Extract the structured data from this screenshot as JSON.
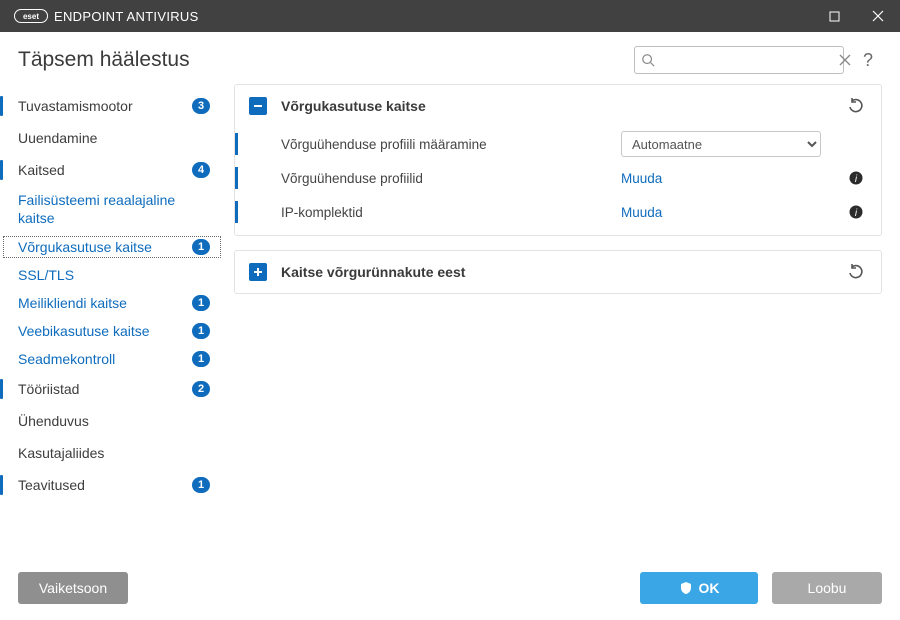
{
  "app": {
    "brand": "ENDPOINT ANTIVIRUS",
    "brand_prefix": "eset"
  },
  "heading": "Täpsem häälestus",
  "search": {
    "placeholder": ""
  },
  "sidebar": {
    "items": [
      {
        "label": "Tuvastamismootor",
        "badge": "3",
        "top": true,
        "marked": true
      },
      {
        "label": "Uuendamine",
        "top": true
      },
      {
        "label": "Kaitsed",
        "badge": "4",
        "top": true,
        "marked": true
      },
      {
        "label": "Failisüsteemi reaalajaline kaitse",
        "lvl2": true,
        "wrap": true
      },
      {
        "label": "Võrgukasutuse kaitse",
        "badge": "1",
        "lvl2": true,
        "selected": true
      },
      {
        "label": "SSL/TLS",
        "lvl2": true
      },
      {
        "label": "Meilikliendi kaitse",
        "badge": "1",
        "lvl2": true
      },
      {
        "label": "Veebikasutuse kaitse",
        "badge": "1",
        "lvl2": true
      },
      {
        "label": "Seadmekontroll",
        "badge": "1",
        "lvl2": true
      },
      {
        "label": "Tööriistad",
        "badge": "2",
        "top": true,
        "marked": true
      },
      {
        "label": "Ühenduvus",
        "top": true
      },
      {
        "label": "Kasutajaliides",
        "top": true
      },
      {
        "label": "Teavitused",
        "badge": "1",
        "top": true,
        "marked": true
      }
    ]
  },
  "panels": {
    "p1": {
      "title": "Võrgukasutuse kaitse",
      "rows": {
        "r1": {
          "label": "Võrguühenduse profiili määramine",
          "dropdown": "Automaatne"
        },
        "r2": {
          "label": "Võrguühenduse profiilid",
          "link": "Muuda"
        },
        "r3": {
          "label": "IP-komplektid",
          "link": "Muuda"
        }
      }
    },
    "p2": {
      "title": "Kaitse võrgurünnakute eest"
    }
  },
  "footer": {
    "default": "Vaiketsoon",
    "ok": "OK",
    "cancel": "Loobu"
  }
}
